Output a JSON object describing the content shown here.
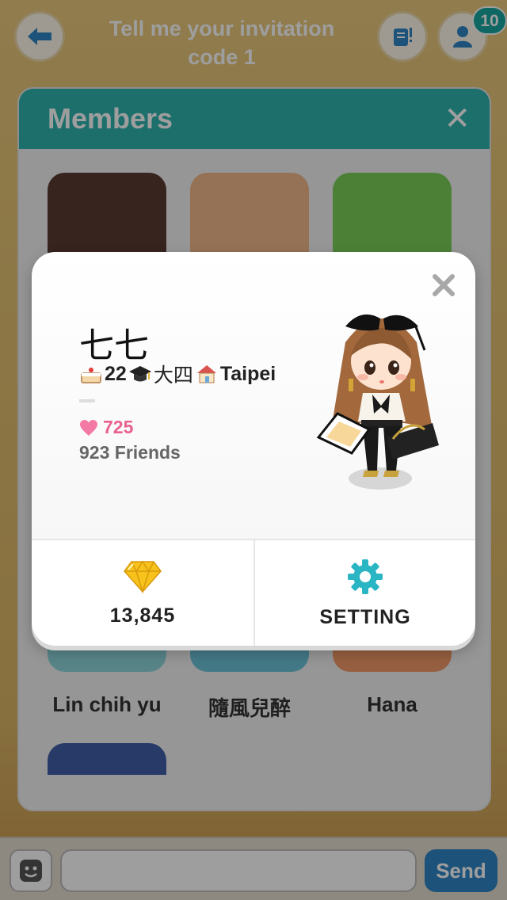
{
  "header": {
    "title": "Tell me your invitation code 1",
    "notification_count": "10"
  },
  "members_panel": {
    "title": "Members",
    "members": [
      {
        "name": ""
      },
      {
        "name": ""
      },
      {
        "name": ""
      },
      {
        "name": "Lin chih yu"
      },
      {
        "name": "隨風兒醉"
      },
      {
        "name": "Hana"
      },
      {
        "name": ""
      }
    ]
  },
  "chat_bar": {
    "send_label": "Send"
  },
  "profile": {
    "name": "七七",
    "age": "22",
    "school_year": "大四",
    "location": "Taipei",
    "likes": "725",
    "friends": "923 Friends",
    "gems": "13,845",
    "setting_label": "SETTING"
  },
  "icons": {
    "back": "back-arrow-icon",
    "notice": "notice-icon",
    "friends": "friends-icon",
    "close": "close-icon",
    "cake": "cake-icon",
    "graduation": "graduation-cap-icon",
    "home": "house-icon",
    "heart": "heart-icon",
    "gem": "diamond-icon",
    "gear": "gear-icon",
    "emoji": "smiley-icon"
  },
  "colors": {
    "teal_accent": "#2fb3ad",
    "like_pink": "#e8618f",
    "gem_yellow": "#f6c21b",
    "gear_teal": "#2ab5c4",
    "send_blue": "#2f86c6"
  }
}
